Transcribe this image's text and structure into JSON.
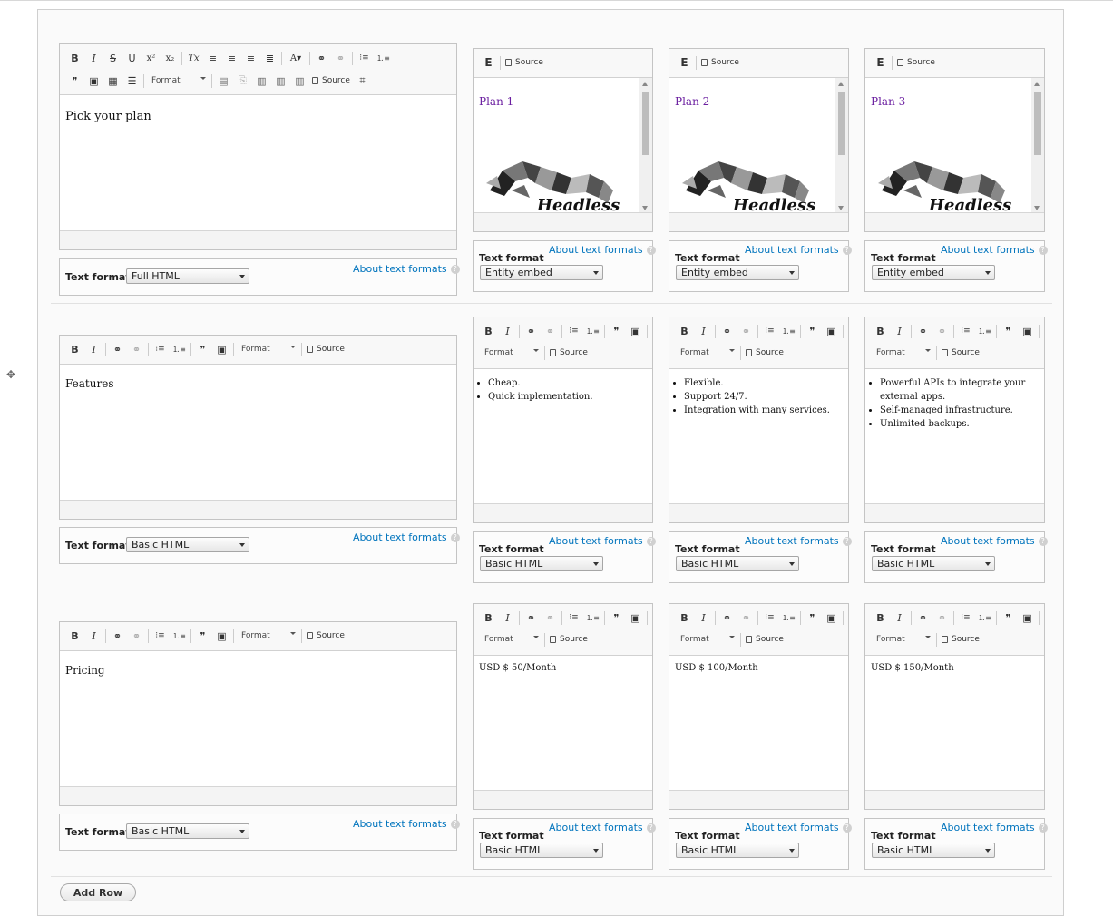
{
  "toolbar_labels": {
    "format": "Format",
    "source": "Source"
  },
  "text_format_label": "Text format",
  "about_text_formats": "About text formats",
  "plans": [
    {
      "title": "Plan 1",
      "logo_text": "Headless"
    },
    {
      "title": "Plan 2",
      "logo_text": "Headless"
    },
    {
      "title": "Plan 3",
      "logo_text": "Headless"
    }
  ],
  "row1": {
    "heading": "Pick your plan",
    "format_value": "Full HTML",
    "cell_format_value": "Entity embed"
  },
  "row2": {
    "heading": "Features",
    "format_value": "Basic HTML",
    "features": [
      [
        "Cheap.",
        "Quick implementation."
      ],
      [
        "Flexible.",
        "Support 24/7.",
        "Integration with many services."
      ],
      [
        "Powerful APIs to integrate your external apps.",
        "Self-managed infrastructure.",
        "Unlimited backups."
      ]
    ]
  },
  "row3": {
    "heading": "Pricing",
    "format_value": "Basic HTML",
    "prices": [
      "USD $ 50/Month",
      "USD $ 100/Month",
      "USD $ 150/Month"
    ]
  },
  "add_row_label": "Add Row"
}
